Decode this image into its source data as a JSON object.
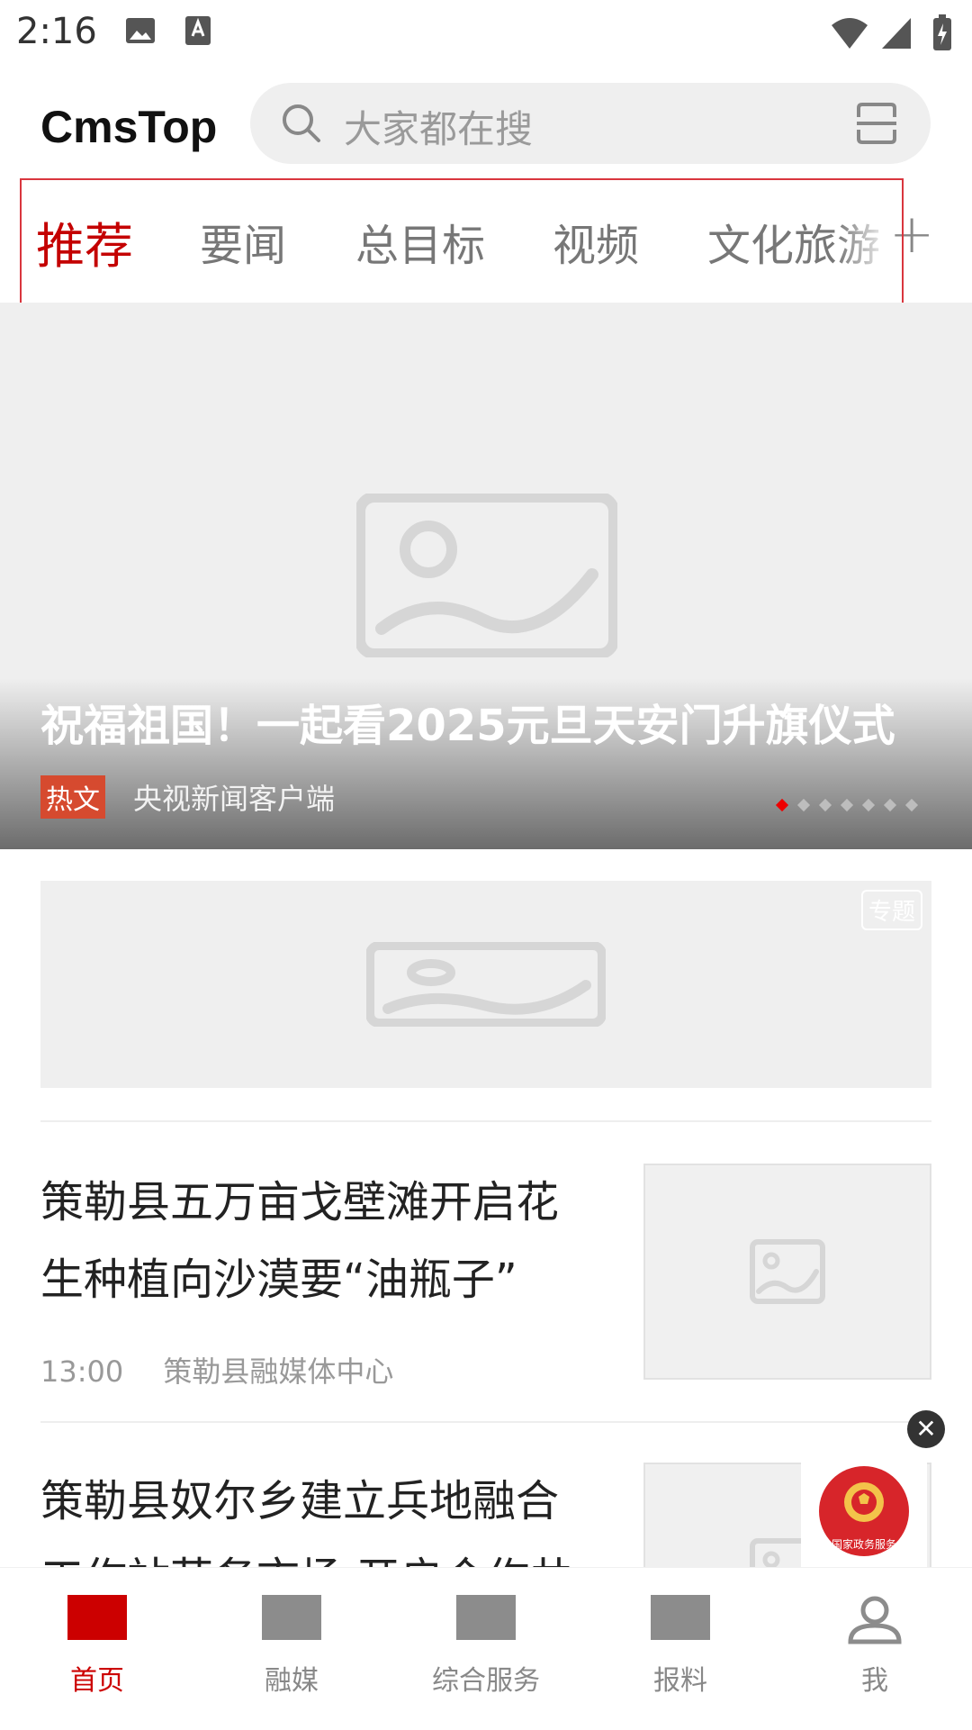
{
  "status_bar": {
    "time": "2:16"
  },
  "header": {
    "logo": "CmsTop",
    "search_placeholder": "大家都在搜"
  },
  "tabs": [
    {
      "label": "推荐",
      "active": true
    },
    {
      "label": "要闻"
    },
    {
      "label": "总目标"
    },
    {
      "label": "视频"
    },
    {
      "label": "文化旅游"
    }
  ],
  "banner": {
    "title": "祝福祖国！一起看2025元旦天安门升旗仪式",
    "tag": "热文",
    "source": "央视新闻客户端",
    "slide_count": 7,
    "active_slide": 1
  },
  "topic_card": {
    "badge": "专题"
  },
  "news": [
    {
      "title": "策勒县五万亩戈壁滩开启花生种植向沙漠要“油瓶子”",
      "time": "13:00",
      "source": "策勒县融媒体中心"
    },
    {
      "title": "策勒县奴尔乡建立兵地融合工作站劳务市场 开启合作共"
    }
  ],
  "floating_badge": {
    "label": "国家政务服务"
  },
  "bottom_nav": [
    {
      "label": "首页",
      "active": true
    },
    {
      "label": "融媒"
    },
    {
      "label": "综合服务"
    },
    {
      "label": "报料"
    },
    {
      "label": "我"
    }
  ],
  "colors": {
    "accent": "#c40000",
    "tag": "#d64a2f"
  }
}
